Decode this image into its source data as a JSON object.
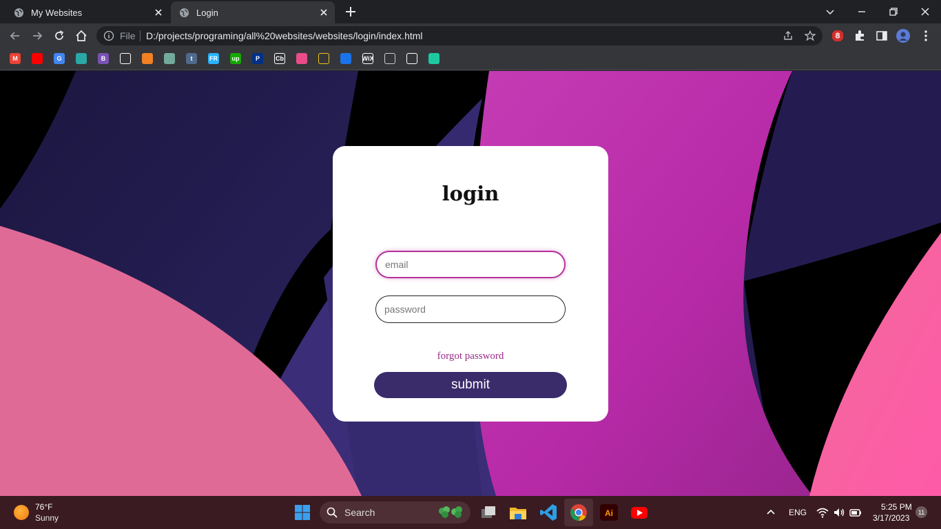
{
  "browser": {
    "tabs": [
      {
        "title": "My Websites",
        "active": false
      },
      {
        "title": "Login",
        "active": true
      }
    ],
    "address": {
      "scheme_label": "File",
      "url": "D:/projects/programing/all%20websites/websites/login/index.html"
    },
    "bookmarks": [
      {
        "icon": "gmail-icon",
        "label": "M",
        "color": "#ea4335"
      },
      {
        "icon": "youtube-icon",
        "label": "",
        "color": "#ff0000"
      },
      {
        "icon": "google-translate-icon",
        "label": "G",
        "color": "#4285f4"
      },
      {
        "icon": "teal-logo-icon",
        "label": "",
        "color": "#2aa7a7"
      },
      {
        "icon": "bootstrap-icon",
        "label": "B",
        "color": "#7952b3"
      },
      {
        "icon": "codepen-icon",
        "label": "",
        "color": "#ffffff"
      },
      {
        "icon": "stack-overflow-icon",
        "label": "",
        "color": "#f48024"
      },
      {
        "icon": "chatgpt-icon",
        "label": "",
        "color": "#74aa9c"
      },
      {
        "icon": "tumblr-icon",
        "label": "t",
        "color": "#4e6a8c"
      },
      {
        "icon": "freelancer-icon",
        "label": "FR",
        "color": "#29b2fe"
      },
      {
        "icon": "upwork-icon",
        "label": "up",
        "color": "#14a800"
      },
      {
        "icon": "paypal-icon",
        "label": "P",
        "color": "#003087"
      },
      {
        "icon": "crunchbase-icon",
        "label": "Cb",
        "color": "#ffffff"
      },
      {
        "icon": "dribbble-icon",
        "label": "",
        "color": "#ea4c89"
      },
      {
        "icon": "shield-logo-icon",
        "label": "",
        "color": "#f5c518"
      },
      {
        "icon": "codecademy-icon",
        "label": "",
        "color": "#1a73e8"
      },
      {
        "icon": "wix-icon",
        "label": "WiX",
        "color": "#ffffff"
      },
      {
        "icon": "dots-logo-icon",
        "label": "",
        "color": "#cccccc"
      },
      {
        "icon": "github-icon",
        "label": "",
        "color": "#ffffff"
      },
      {
        "icon": "green-ring-icon",
        "label": "",
        "color": "#1dc9a1"
      }
    ]
  },
  "login": {
    "title": "login",
    "email_placeholder": "email",
    "password_placeholder": "password",
    "forgot_label": "forgot password",
    "submit_label": "submit"
  },
  "taskbar": {
    "weather_temp": "76°F",
    "weather_desc": "Sunny",
    "search_label": "Search",
    "language": "ENG",
    "time": "5:25 PM",
    "date": "3/17/2023",
    "notification_count": "11"
  },
  "colors": {
    "accent_pink": "#b5329b",
    "submit_bg": "#3a2b6b",
    "forgot_link": "#9b2a8a"
  }
}
